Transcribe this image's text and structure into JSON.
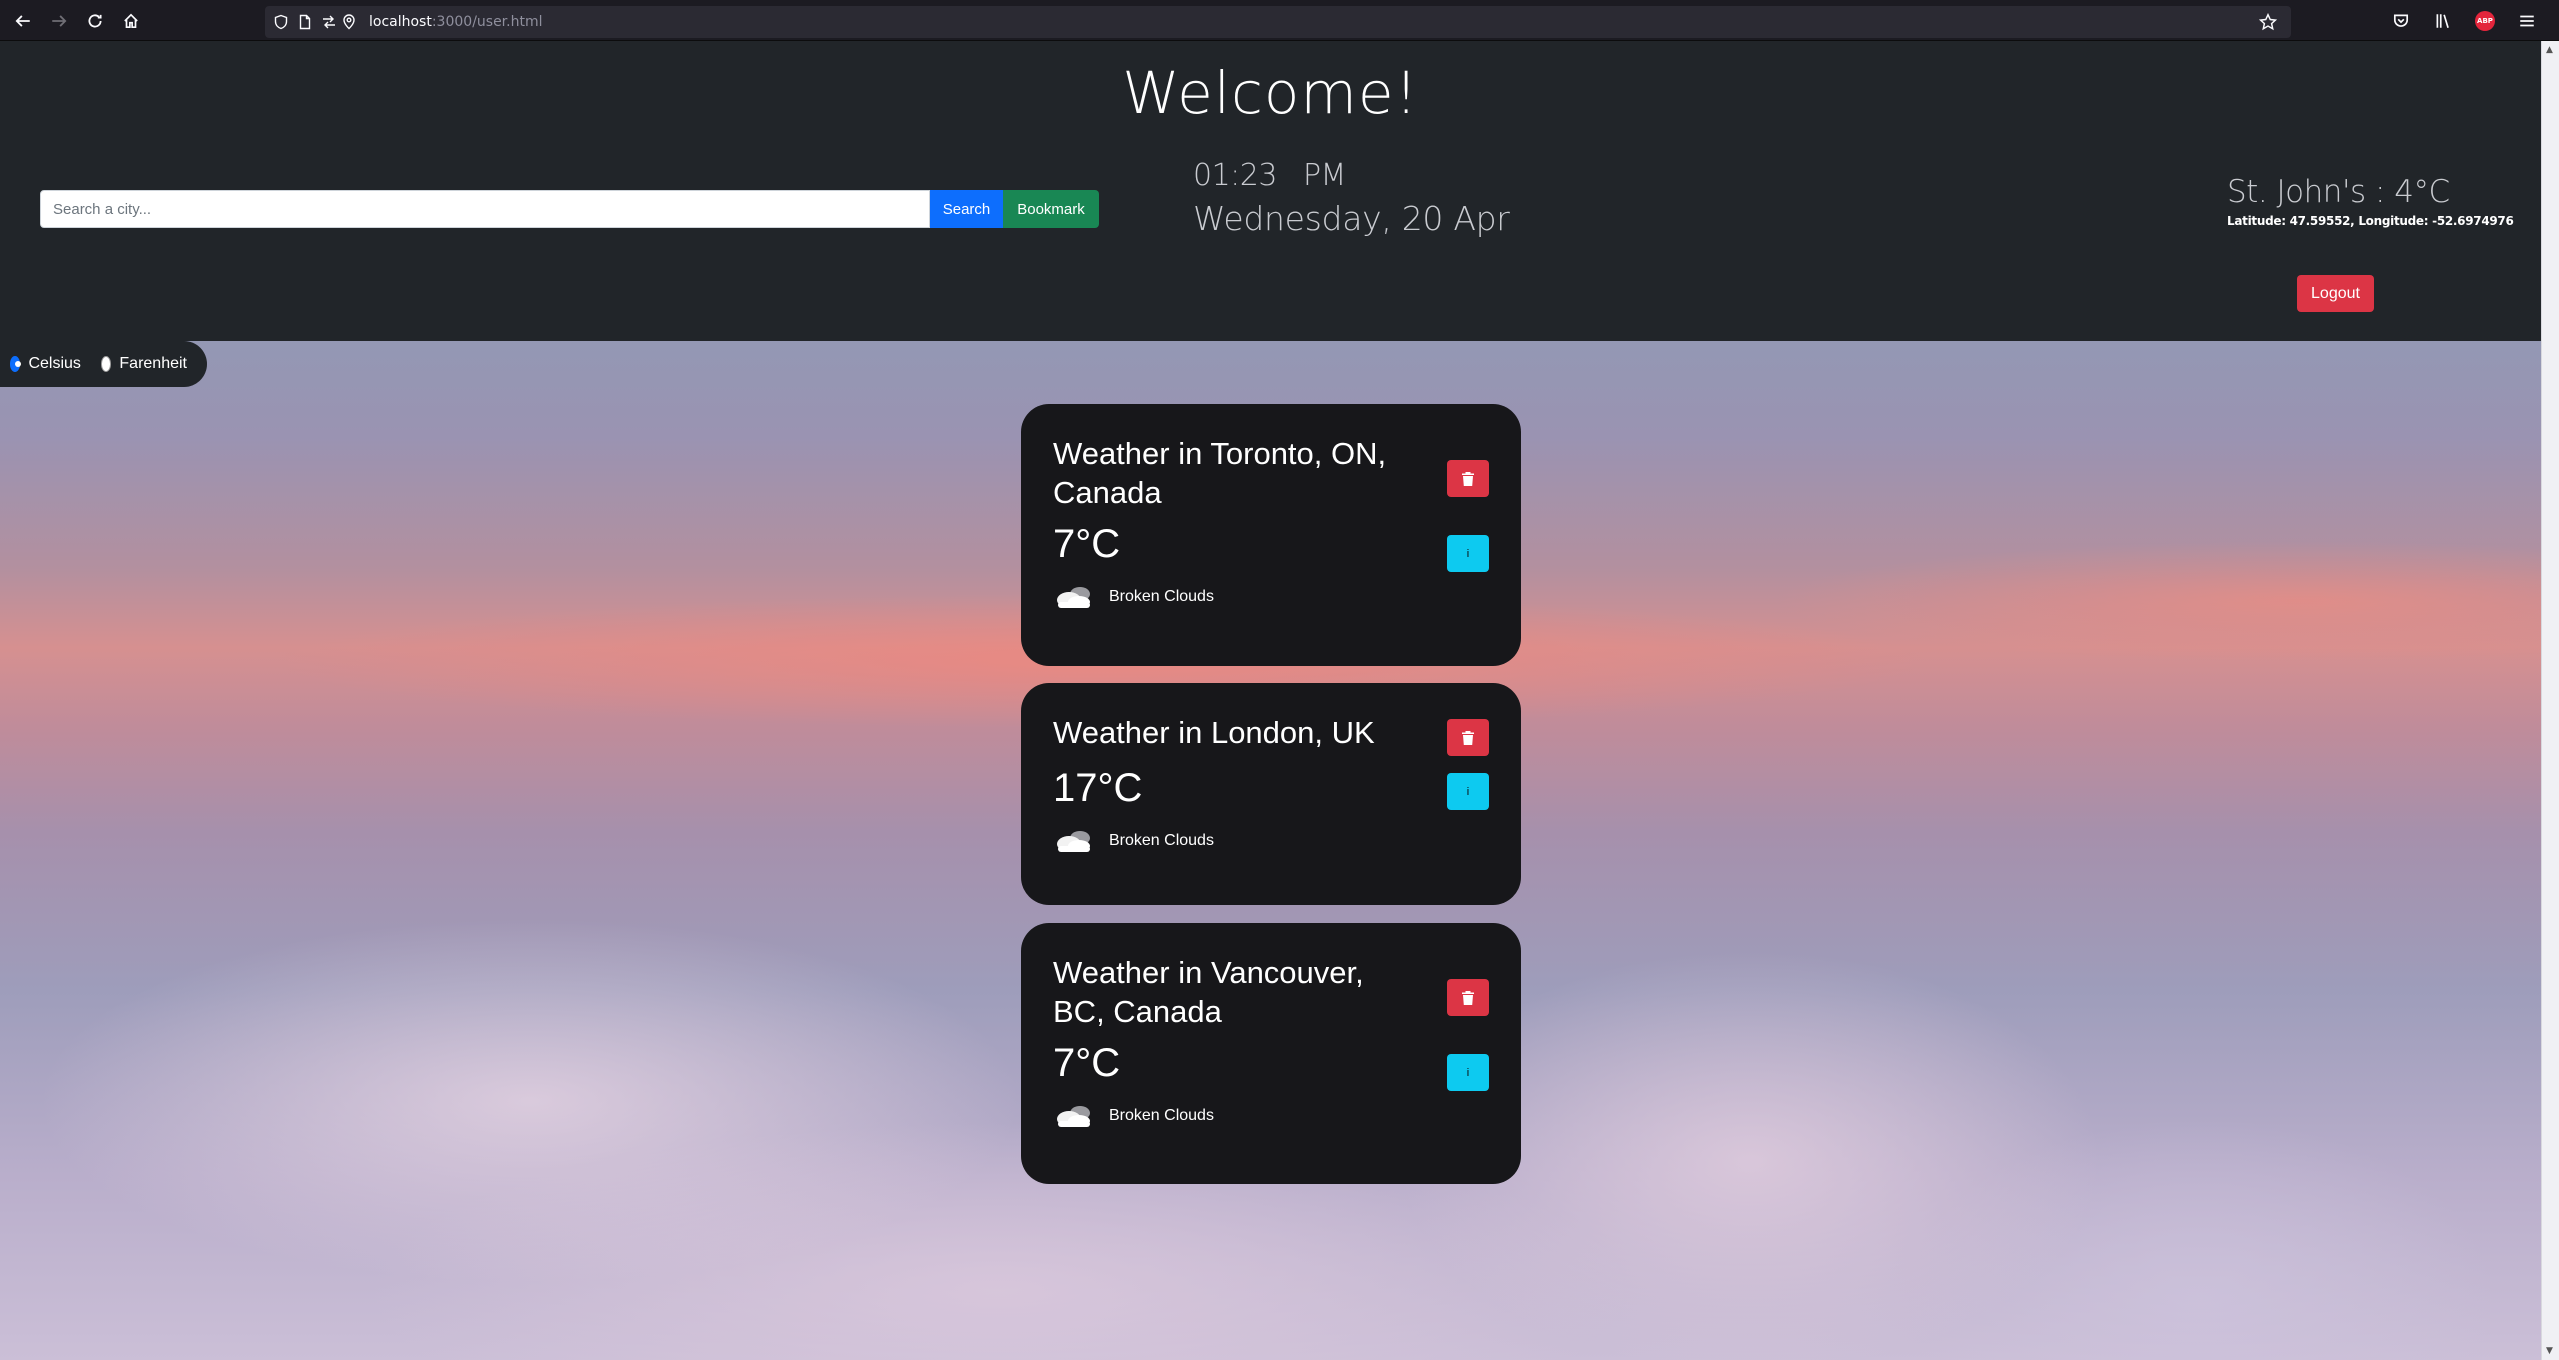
{
  "browser": {
    "url_host": "localhost",
    "url_path": ":3000/user.html"
  },
  "header": {
    "title": "Welcome!",
    "search": {
      "placeholder": "Search a city...",
      "search_label": "Search",
      "bookmark_label": "Bookmark"
    },
    "clock": {
      "time": "01:23",
      "ampm": "PM",
      "date": "Wednesday, 20 Apr"
    },
    "location": {
      "title": "St. John's : 4°C",
      "coords": "Latitude: 47.59552, Longitude: -52.6974976"
    },
    "logout_label": "Logout"
  },
  "units": {
    "celsius_label": "Celsius",
    "fahrenheit_label": "Farenheit",
    "selected": "celsius"
  },
  "cards": [
    {
      "title": "Weather in Toronto, ON, Canada",
      "temp": "7°C",
      "desc": "Broken Clouds",
      "info_label": "i"
    },
    {
      "title": "Weather in London, UK",
      "temp": "17°C",
      "desc": "Broken Clouds",
      "info_label": "i"
    },
    {
      "title": "Weather in Vancouver, BC, Canada",
      "temp": "7°C",
      "desc": "Broken Clouds",
      "info_label": "i"
    }
  ],
  "colors": {
    "danger": "#dc3545",
    "info": "#0dcaf0",
    "primary": "#0d6efd",
    "success": "#198754",
    "header_bg": "#212529"
  }
}
